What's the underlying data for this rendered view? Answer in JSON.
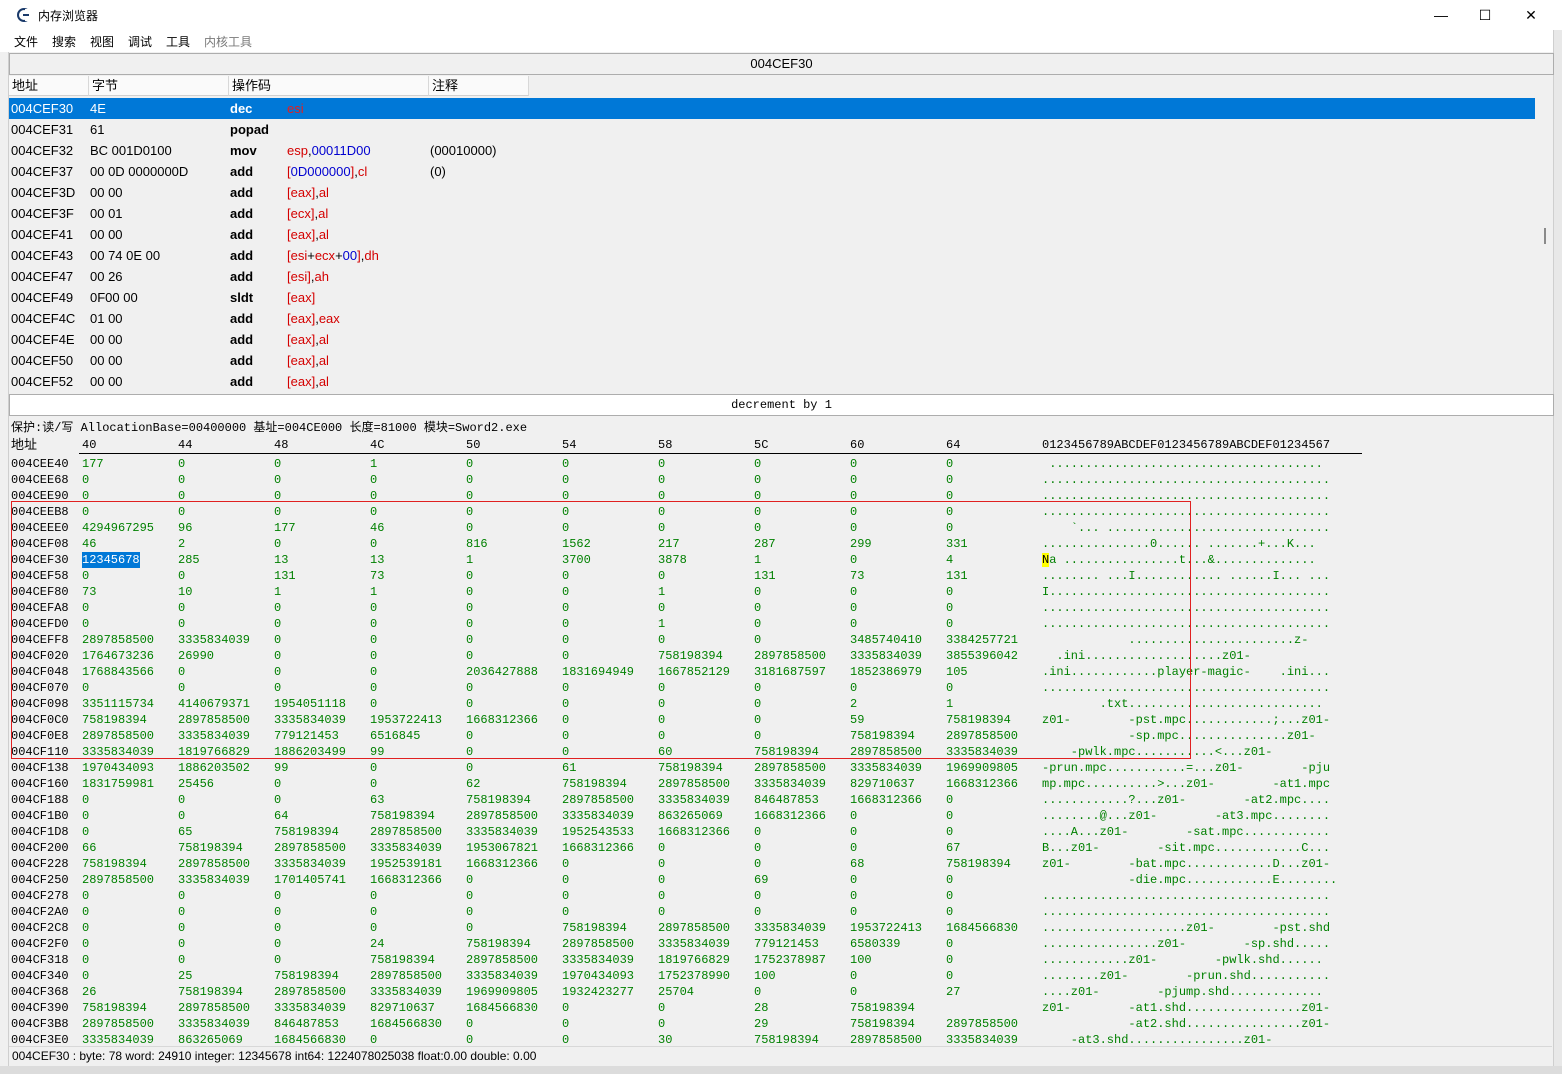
{
  "window": {
    "title": "内存浏览器",
    "minimize": "—",
    "maximize": "☐",
    "close": "✕",
    "icon": "cheat-engine-icon"
  },
  "menu": [
    "文件",
    "搜索",
    "视图",
    "调试",
    "工具",
    "内核工具"
  ],
  "address_bar": "004CEF30",
  "disasm": {
    "columns": [
      "地址",
      "字节",
      "操作码",
      "注释"
    ],
    "rows": [
      {
        "addr": "004CEF30",
        "bytes": "4E",
        "op": "dec",
        "args": [
          [
            "r",
            "esi"
          ]
        ],
        "comment": "",
        "selected": true
      },
      {
        "addr": "004CEF31",
        "bytes": "61",
        "op": "popad",
        "args": [],
        "comment": ""
      },
      {
        "addr": "004CEF32",
        "bytes": "BC 001D0100",
        "op": "mov",
        "args": [
          [
            "r",
            "esp"
          ],
          [
            "t",
            ","
          ],
          [
            "n",
            "00011D00"
          ]
        ],
        "comment": "(00010000)"
      },
      {
        "addr": "004CEF37",
        "bytes": "00 0D 0000000D",
        "op": "add",
        "args": [
          [
            "r",
            "["
          ],
          [
            "n",
            "0D000000"
          ],
          [
            "r",
            "]"
          ],
          [
            "t",
            ","
          ],
          [
            "r",
            "cl"
          ]
        ],
        "comment": "(0)"
      },
      {
        "addr": "004CEF3D",
        "bytes": "00 00",
        "op": "add",
        "args": [
          [
            "r",
            "[eax]"
          ],
          [
            "t",
            ","
          ],
          [
            "r",
            "al"
          ]
        ],
        "comment": ""
      },
      {
        "addr": "004CEF3F",
        "bytes": "00 01",
        "op": "add",
        "args": [
          [
            "r",
            "[ecx]"
          ],
          [
            "t",
            ","
          ],
          [
            "r",
            "al"
          ]
        ],
        "comment": ""
      },
      {
        "addr": "004CEF41",
        "bytes": "00 00",
        "op": "add",
        "args": [
          [
            "r",
            "[eax]"
          ],
          [
            "t",
            ","
          ],
          [
            "r",
            "al"
          ]
        ],
        "comment": ""
      },
      {
        "addr": "004CEF43",
        "bytes": "00 74 0E 00",
        "op": "add",
        "args": [
          [
            "r",
            "[esi"
          ],
          [
            "t",
            "+"
          ],
          [
            "r",
            "ecx"
          ],
          [
            "t",
            "+"
          ],
          [
            "n",
            "00"
          ],
          [
            "r",
            "]"
          ],
          [
            "t",
            ","
          ],
          [
            "r",
            "dh"
          ]
        ],
        "comment": ""
      },
      {
        "addr": "004CEF47",
        "bytes": "00 26",
        "op": "add",
        "args": [
          [
            "r",
            "[esi]"
          ],
          [
            "t",
            ","
          ],
          [
            "r",
            "ah"
          ]
        ],
        "comment": ""
      },
      {
        "addr": "004CEF49",
        "bytes": "0F00 00",
        "op": "sldt",
        "args": [
          [
            "r",
            "[eax]"
          ]
        ],
        "comment": ""
      },
      {
        "addr": "004CEF4C",
        "bytes": "01 00",
        "op": "add",
        "args": [
          [
            "r",
            "[eax]"
          ],
          [
            "t",
            ","
          ],
          [
            "r",
            "eax"
          ]
        ],
        "comment": ""
      },
      {
        "addr": "004CEF4E",
        "bytes": "00 00",
        "op": "add",
        "args": [
          [
            "r",
            "[eax]"
          ],
          [
            "t",
            ","
          ],
          [
            "r",
            "al"
          ]
        ],
        "comment": ""
      },
      {
        "addr": "004CEF50",
        "bytes": "00 00",
        "op": "add",
        "args": [
          [
            "r",
            "[eax]"
          ],
          [
            "t",
            ","
          ],
          [
            "r",
            "al"
          ]
        ],
        "comment": ""
      },
      {
        "addr": "004CEF52",
        "bytes": "00 00",
        "op": "add",
        "args": [
          [
            "r",
            "[eax]"
          ],
          [
            "t",
            ","
          ],
          [
            "r",
            "al"
          ]
        ],
        "comment": ""
      }
    ]
  },
  "instruction_description": "decrement by 1",
  "hex": {
    "info": "保护:读/写  AllocationBase=00400000 基址=004CE000 长度=81000 模块=Sword2.exe",
    "addr_header": "地址",
    "col_headers": [
      "40",
      "44",
      "48",
      "4C",
      "50",
      "54",
      "58",
      "5C",
      "60",
      "64"
    ],
    "ascii_header": "0123456789ABCDEF0123456789ABCDEF01234567",
    "rows": [
      {
        "addr": "004CEE40",
        "v": [
          "177",
          "0",
          "0",
          "1",
          "0",
          "0",
          "0",
          "0",
          "0",
          "0"
        ],
        "a": " ......................................"
      },
      {
        "addr": "004CEE68",
        "v": [
          "0",
          "0",
          "0",
          "0",
          "0",
          "0",
          "0",
          "0",
          "0",
          "0"
        ],
        "a": "........................................"
      },
      {
        "addr": "004CEE90",
        "v": [
          "0",
          "0",
          "0",
          "0",
          "0",
          "0",
          "0",
          "0",
          "0",
          "0"
        ],
        "a": "........................................"
      },
      {
        "addr": "004CEEB8",
        "v": [
          "0",
          "0",
          "0",
          "0",
          "0",
          "0",
          "0",
          "0",
          "0",
          "0"
        ],
        "a": "........................................"
      },
      {
        "addr": "004CEEE0",
        "v": [
          "4294967295",
          "96",
          "177",
          "46",
          "0",
          "0",
          "0",
          "0",
          "0",
          "0"
        ],
        "a": "    `... ..............................."
      },
      {
        "addr": "004CEF08",
        "v": [
          "46",
          "2",
          "0",
          "0",
          "816",
          "1562",
          "217",
          "287",
          "299",
          "331"
        ],
        "a": "...............0...... .......+...K..."
      },
      {
        "addr": "004CEF30",
        "v": [
          "12345678",
          "285",
          "13",
          "13",
          "1",
          "3700",
          "3878",
          "1",
          "0",
          "4"
        ],
        "a": "Na ................t...&.............."
      },
      {
        "addr": "004CEF58",
        "v": [
          "0",
          "0",
          "131",
          "73",
          "0",
          "0",
          "0",
          "131",
          "73",
          "131"
        ],
        "a": "........ ...I............ ......I... ..."
      },
      {
        "addr": "004CEF80",
        "v": [
          "73",
          "10",
          "1",
          "1",
          "0",
          "0",
          "1",
          "0",
          "0",
          "0"
        ],
        "a": "I......................................."
      },
      {
        "addr": "004CEFA8",
        "v": [
          "0",
          "0",
          "0",
          "0",
          "0",
          "0",
          "0",
          "0",
          "0",
          "0"
        ],
        "a": "........................................"
      },
      {
        "addr": "004CEFD0",
        "v": [
          "0",
          "0",
          "0",
          "0",
          "0",
          "0",
          "1",
          "0",
          "0",
          "0"
        ],
        "a": "........................................"
      },
      {
        "addr": "004CEFF8",
        "v": [
          "2897858500",
          "3335834039",
          "0",
          "0",
          "0",
          "0",
          "0",
          "0",
          "3485740410",
          "3384257721"
        ],
        "a": "            .......................z-"
      },
      {
        "addr": "004CF020",
        "v": [
          "1764673236",
          "26990",
          "0",
          "0",
          "0",
          "0",
          "758198394",
          "2897858500",
          "3335834039",
          "3855396042"
        ],
        "a": "  .ini...................z01-"
      },
      {
        "addr": "004CF048",
        "v": [
          "1768843566",
          "0",
          "0",
          "0",
          "2036427888",
          "1831694949",
          "1667852129",
          "3181687597",
          "1852386979",
          "105"
        ],
        "a": ".ini............player-magic-    .ini..."
      },
      {
        "addr": "004CF070",
        "v": [
          "0",
          "0",
          "0",
          "0",
          "0",
          "0",
          "0",
          "0",
          "0",
          "0"
        ],
        "a": "........................................"
      },
      {
        "addr": "004CF098",
        "v": [
          "3351115734",
          "4140679371",
          "1954051118",
          "0",
          "0",
          "0",
          "0",
          "0",
          "2",
          "1"
        ],
        "a": "        .txt..........................."
      },
      {
        "addr": "004CF0C0",
        "v": [
          "758198394",
          "2897858500",
          "3335834039",
          "1953722413",
          "1668312366",
          "0",
          "0",
          "0",
          "59",
          "758198394"
        ],
        "a": "z01-        -pst.mpc............;...z01-"
      },
      {
        "addr": "004CF0E8",
        "v": [
          "2897858500",
          "3335834039",
          "779121453",
          "6516845",
          "0",
          "0",
          "0",
          "0",
          "758198394",
          "2897858500"
        ],
        "a": "            -sp.mpc...............z01-"
      },
      {
        "addr": "004CF110",
        "v": [
          "3335834039",
          "1819766829",
          "1886203499",
          "99",
          "0",
          "0",
          "60",
          "758198394",
          "2897858500",
          "3335834039"
        ],
        "a": "    -pwlk.mpc...........<...z01-"
      },
      {
        "addr": "004CF138",
        "v": [
          "1970434093",
          "1886203502",
          "99",
          "0",
          "0",
          "61",
          "758198394",
          "2897858500",
          "3335834039",
          "1969909805"
        ],
        "a": "-prun.mpc...........=...z01-        -pju"
      },
      {
        "addr": "004CF160",
        "v": [
          "1831759981",
          "25456",
          "0",
          "0",
          "62",
          "758198394",
          "2897858500",
          "3335834039",
          "829710637",
          "1668312366"
        ],
        "a": "mp.mpc..........>...z01-        -at1.mpc"
      },
      {
        "addr": "004CF188",
        "v": [
          "0",
          "0",
          "0",
          "63",
          "758198394",
          "2897858500",
          "3335834039",
          "846487853",
          "1668312366",
          "0"
        ],
        "a": "............?...z01-        -at2.mpc...."
      },
      {
        "addr": "004CF1B0",
        "v": [
          "0",
          "0",
          "64",
          "758198394",
          "2897858500",
          "3335834039",
          "863265069",
          "1668312366",
          "0",
          "0"
        ],
        "a": "........@...z01-        -at3.mpc........"
      },
      {
        "addr": "004CF1D8",
        "v": [
          "0",
          "65",
          "758198394",
          "2897858500",
          "3335834039",
          "1952543533",
          "1668312366",
          "0",
          "0",
          "0"
        ],
        "a": "....A...z01-        -sat.mpc............"
      },
      {
        "addr": "004CF200",
        "v": [
          "66",
          "758198394",
          "2897858500",
          "3335834039",
          "1953067821",
          "1668312366",
          "0",
          "0",
          "0",
          "67"
        ],
        "a": "B...z01-        -sit.mpc............C..."
      },
      {
        "addr": "004CF228",
        "v": [
          "758198394",
          "2897858500",
          "3335834039",
          "1952539181",
          "1668312366",
          "0",
          "0",
          "0",
          "68",
          "758198394"
        ],
        "a": "z01-        -bat.mpc............D...z01-"
      },
      {
        "addr": "004CF250",
        "v": [
          "2897858500",
          "3335834039",
          "1701405741",
          "1668312366",
          "0",
          "0",
          "0",
          "69",
          "0",
          "0"
        ],
        "a": "            -die.mpc............E........"
      },
      {
        "addr": "004CF278",
        "v": [
          "0",
          "0",
          "0",
          "0",
          "0",
          "0",
          "0",
          "0",
          "0",
          "0"
        ],
        "a": "........................................"
      },
      {
        "addr": "004CF2A0",
        "v": [
          "0",
          "0",
          "0",
          "0",
          "0",
          "0",
          "0",
          "0",
          "0",
          "0"
        ],
        "a": "........................................"
      },
      {
        "addr": "004CF2C8",
        "v": [
          "0",
          "0",
          "0",
          "0",
          "0",
          "758198394",
          "2897858500",
          "3335834039",
          "1953722413",
          "1684566830"
        ],
        "a": "....................z01-        -pst.shd"
      },
      {
        "addr": "004CF2F0",
        "v": [
          "0",
          "0",
          "0",
          "24",
          "758198394",
          "2897858500",
          "3335834039",
          "779121453",
          "6580339",
          "0"
        ],
        "a": "................z01-        -sp.shd....."
      },
      {
        "addr": "004CF318",
        "v": [
          "0",
          "0",
          "0",
          "758198394",
          "2897858500",
          "3335834039",
          "1819766829",
          "1752378987",
          "100",
          "0"
        ],
        "a": "............z01-        -pwlk.shd......"
      },
      {
        "addr": "004CF340",
        "v": [
          "0",
          "25",
          "758198394",
          "2897858500",
          "3335834039",
          "1970434093",
          "1752378990",
          "100",
          "0",
          "0"
        ],
        "a": "........z01-        -prun.shd..........."
      },
      {
        "addr": "004CF368",
        "v": [
          "26",
          "758198394",
          "2897858500",
          "3335834039",
          "1969909805",
          "1932423277",
          "25704",
          "0",
          "0",
          "27"
        ],
        "a": "....z01-        -pjump.shd............."
      },
      {
        "addr": "004CF390",
        "v": [
          "758198394",
          "2897858500",
          "3335834039",
          "829710637",
          "1684566830",
          "0",
          "0",
          "28",
          "758198394"
        ],
        "a": "z01-        -at1.shd................z01-"
      },
      {
        "addr": "004CF3B8",
        "v": [
          "2897858500",
          "3335834039",
          "846487853",
          "1684566830",
          "0",
          "0",
          "0",
          "29",
          "758198394",
          "2897858500"
        ],
        "a": "            -at2.shd................z01-"
      },
      {
        "addr": "004CF3E0",
        "v": [
          "3335834039",
          "863265069",
          "1684566830",
          "0",
          "0",
          "0",
          "30",
          "758198394",
          "2897858500",
          "3335834039"
        ],
        "a": "    -at3.shd................z01-"
      }
    ]
  },
  "status": "004CEF30 : byte: 78 word: 24910 integer: 12345678 int64: 1224078025038 float:0.00 double: 0.00"
}
